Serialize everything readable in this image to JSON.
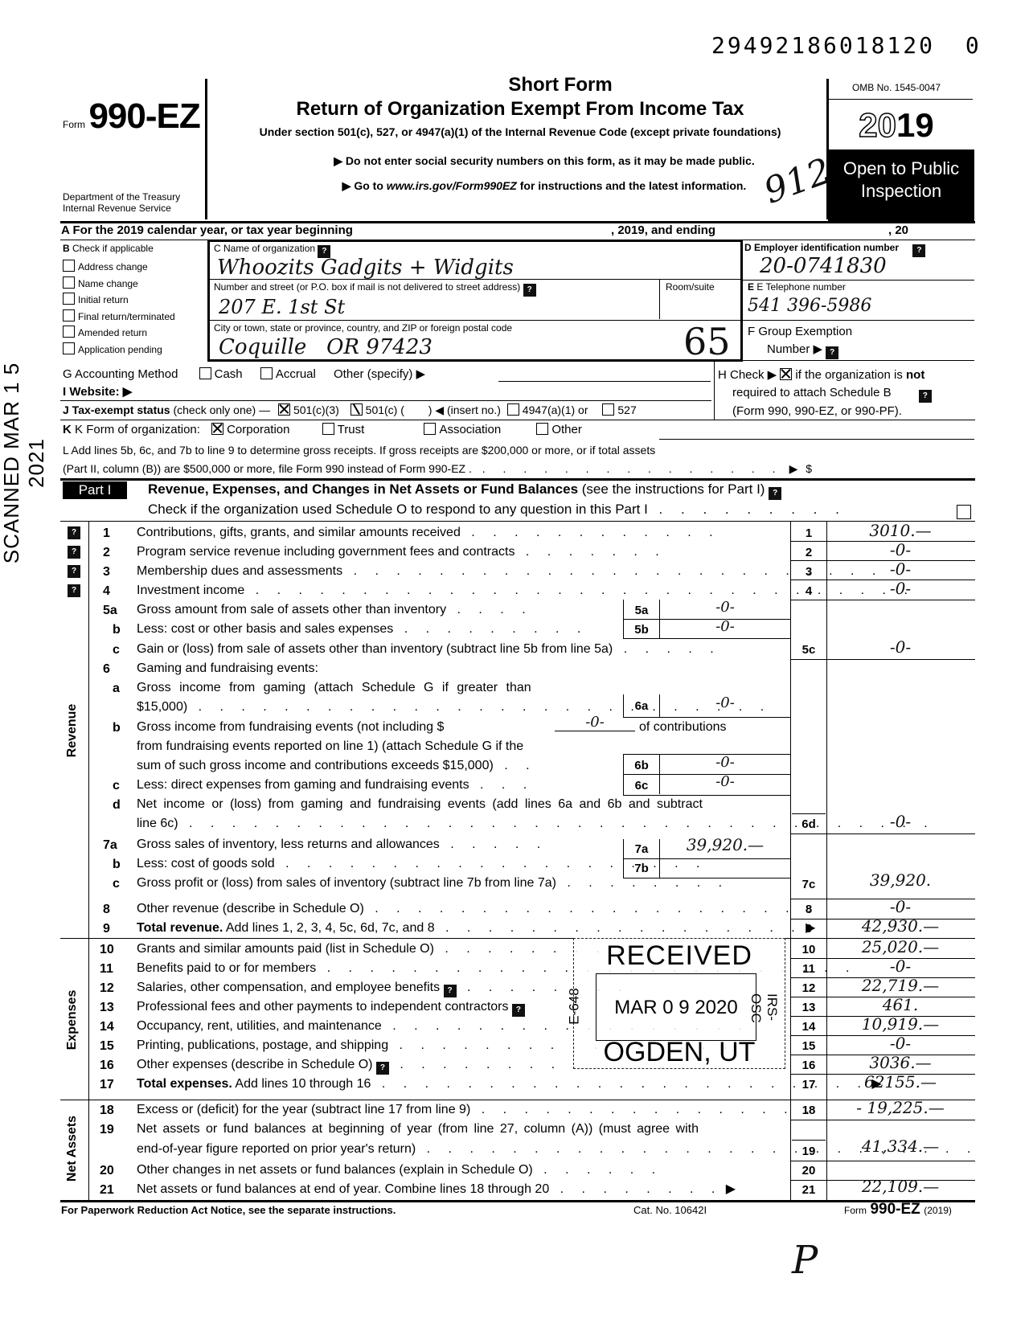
{
  "doc_locator_number": "29492186018120",
  "doc_locator_suffix": "0",
  "header": {
    "form_word": "Form",
    "form_number": "990-EZ",
    "dept_line1": "Department of the Treasury",
    "dept_line2": "Internal Revenue Service",
    "title1": "Short Form",
    "title2": "Return of Organization Exempt From Income Tax",
    "subtitle": "Under section 501(c), 527, or 4947(a)(1) of the Internal Revenue Code (except private foundations)",
    "note1": "▶ Do not enter social security numbers on this form, as it may be made public.",
    "note2_prefix": "▶ Go to ",
    "note2_url": "www.irs.gov/Form990EZ",
    "note2_suffix": " for instructions and the latest information.",
    "omb": "OMB No. 1545-0047",
    "year_outline": "20",
    "year_bold": "19",
    "open_public_1": "Open to Public",
    "open_public_2": "Inspection",
    "handwritten_912": "912"
  },
  "line_a": {
    "label": "A  For the 2019 calendar year, or tax year beginning",
    "mid": ", 2019, and ending",
    "end": ", 20"
  },
  "section_b": {
    "title": "B",
    "title_text": "Check if applicable",
    "items": [
      {
        "label": "Address change",
        "checked": false
      },
      {
        "label": "Name change",
        "checked": false
      },
      {
        "label": "Initial return",
        "checked": false
      },
      {
        "label": "Final return/terminated",
        "checked": false
      },
      {
        "label": "Amended return",
        "checked": false
      },
      {
        "label": "Application pending",
        "checked": false
      }
    ]
  },
  "section_c": {
    "name_label": "C Name of organization",
    "name_value": "Whoozits Gadgits + Widgits",
    "street_label": "Number and street (or P.O. box if mail is not delivered to street address)",
    "street_value": "207 E. 1st St",
    "room_label": "Room/suite",
    "room_value": "",
    "city_label": "City or town, state or province, country, and ZIP or foreign postal code",
    "city_value": "Coquille   OR 97423",
    "handwritten_code": "65"
  },
  "section_d": {
    "label": "D Employer identification number",
    "value": "20-0741830"
  },
  "section_e": {
    "label": "E  Telephone number",
    "value": "541 396-5986"
  },
  "section_f": {
    "label": "F  Group Exemption",
    "label2": "Number ▶"
  },
  "section_g": {
    "label": "G  Accounting Method",
    "cash": "Cash",
    "accrual": "Accrual",
    "other": "Other (specify) ▶"
  },
  "section_h": {
    "text1_a": "H  Check ▶",
    "text1_b": "if the organization is",
    "text1_bold": "not",
    "text2": "required to attach Schedule B",
    "text3": "(Form 990, 990-EZ, or 990-PF).",
    "checked": true
  },
  "section_i": {
    "label": "I  Website: ▶",
    "value": ""
  },
  "section_j": {
    "label_bold": "J  Tax-exempt status",
    "label_rest": " (check only one) —",
    "opt1": "501(c)(3)",
    "opt2": "501(c) (",
    "opt2_end": ") ◀ (insert no.)",
    "opt3": "4947(a)(1) or",
    "opt4": "527"
  },
  "section_k": {
    "label": "K  Form of organization:",
    "corporation": "Corporation",
    "trust": "Trust",
    "association": "Association",
    "other": "Other"
  },
  "section_l": {
    "line1": "L  Add lines 5b, 6c, and 7b to line 9 to determine gross receipts. If gross receipts are $200,000 or more, or if total assets",
    "line2": "(Part II, column (B)) are $500,000 or more, file Form 990 instead of Form 990-EZ .",
    "arrow": "▶",
    "dollar": "$"
  },
  "part1": {
    "tag": "Part I",
    "title_bold": "Revenue, Expenses, and Changes in Net Assets or Fund Balances",
    "title_rest": " (see the instructions for Part I)",
    "check_text": "Check if the organization used Schedule O to respond to any question in this Part I",
    "section_labels": {
      "revenue": "Revenue",
      "expenses": "Expenses",
      "net_assets": "Net Assets"
    },
    "lines": [
      {
        "num": "1",
        "text": "Contributions, gifts, grants, and similar amounts received",
        "box": "1",
        "value": "3010.—"
      },
      {
        "num": "2",
        "text": "Program service revenue including government fees and contracts",
        "box": "2",
        "value": "-0-"
      },
      {
        "num": "3",
        "text": "Membership dues and assessments",
        "box": "3",
        "value": "-0-"
      },
      {
        "num": "4",
        "text": "Investment income",
        "box": "4",
        "value": "-0-"
      },
      {
        "num": "5a",
        "text": "Gross amount from sale of assets other than inventory",
        "inner_box": "5a",
        "inner_value": "-0-"
      },
      {
        "num": "b",
        "text": "Less: cost or other basis and sales expenses",
        "inner_box": "5b",
        "inner_value": "-0-"
      },
      {
        "num": "c",
        "text": "Gain or (loss) from sale of assets other than inventory (subtract line 5b from line 5a)",
        "box": "5c",
        "value": "-0-"
      },
      {
        "num": "6",
        "text": "Gaming and fundraising events:"
      },
      {
        "num": "a",
        "text": "Gross income from gaming (attach Schedule G if greater than",
        "text2": "$15,000)",
        "inner_box": "6a",
        "inner_value": "-0-"
      },
      {
        "num": "b",
        "text": "Gross income from fundraising events (not including  $",
        "text_value": "-0-",
        "text_after": "of contributions",
        "text2": "from fundraising events reported on line 1) (attach Schedule G if the",
        "text3": "sum of such gross income and contributions exceeds $15,000)",
        "inner_box": "6b",
        "inner_value": "-0-"
      },
      {
        "num": "c",
        "text": "Less: direct expenses from gaming and fundraising events",
        "inner_box": "6c",
        "inner_value": "-0-"
      },
      {
        "num": "d",
        "text": "Net income or (loss) from gaming and fundraising events (add lines 6a and 6b and subtract",
        "text2": "line 6c)",
        "box": "6d",
        "value": "-0-"
      },
      {
        "num": "7a",
        "text": "Gross sales of inventory, less returns and allowances",
        "inner_box": "7a",
        "inner_value": "39,920.—"
      },
      {
        "num": "b",
        "text": "Less: cost of goods sold",
        "inner_box": "7b",
        "inner_value": ""
      },
      {
        "num": "c",
        "text": "Gross profit or (loss) from sales of inventory (subtract line 7b from line 7a)",
        "box": "7c",
        "value": "39,920."
      },
      {
        "num": "8",
        "text": "Other revenue (describe in Schedule O)",
        "box": "8",
        "value": "-0-"
      },
      {
        "num": "9",
        "text_bold": "Total revenue.",
        "text": " Add lines 1, 2, 3, 4, 5c, 6d, 7c, and 8",
        "box": "9",
        "value": "42,930.—"
      },
      {
        "num": "10",
        "text": "Grants and similar amounts paid (list in Schedule O)",
        "box": "10",
        "value": "25,020.—"
      },
      {
        "num": "11",
        "text": "Benefits paid to or for members",
        "box": "11",
        "value": "-0-"
      },
      {
        "num": "12",
        "text": "Salaries, other compensation, and employee benefits",
        "box": "12",
        "value": "22,719.—"
      },
      {
        "num": "13",
        "text": "Professional fees and other payments to independent contractors",
        "box": "13",
        "value": "461."
      },
      {
        "num": "14",
        "text": "Occupancy, rent, utilities, and maintenance",
        "box": "14",
        "value": "10,919.—"
      },
      {
        "num": "15",
        "text": "Printing, publications, postage, and shipping",
        "box": "15",
        "value": "-0-"
      },
      {
        "num": "16",
        "text": "Other expenses (describe in Schedule O)",
        "box": "16",
        "value": "3036.—"
      },
      {
        "num": "17",
        "text_bold": "Total expenses.",
        "text": " Add lines 10 through 16",
        "box": "17",
        "value": "62155.—"
      },
      {
        "num": "18",
        "text": "Excess or (deficit) for the year (subtract line 17 from line 9)",
        "box": "18",
        "value": "- 19,225.—"
      },
      {
        "num": "19",
        "text": "Net assets or fund balances at beginning of year (from line 27, column (A)) (must agree with",
        "text2": "end-of-year figure reported on prior year's return)",
        "box": "19",
        "value": "41,334.—"
      },
      {
        "num": "20",
        "text": "Other changes in net assets or fund balances (explain in Schedule O)",
        "box": "20",
        "value": ""
      },
      {
        "num": "21",
        "text": "Net assets or fund balances at end of year. Combine lines 18 through 20",
        "box": "21",
        "value": "22,109.—"
      }
    ]
  },
  "stamp": {
    "received": "RECEIVED",
    "date": "MAR 0 9 2020",
    "city": "OGDEN, UT",
    "left_code": "E-648",
    "right_code": "IRS-OSC"
  },
  "scanned_stamp": "SCANNED  MAR 1 5 2021",
  "footer": {
    "paperwork": "For Paperwork Reduction Act Notice, see the separate instructions.",
    "cat_no": "Cat. No. 10642I",
    "form_word": "Form",
    "form_number": "990-EZ",
    "form_year": "(2019)",
    "handwritten_mark": "P"
  }
}
